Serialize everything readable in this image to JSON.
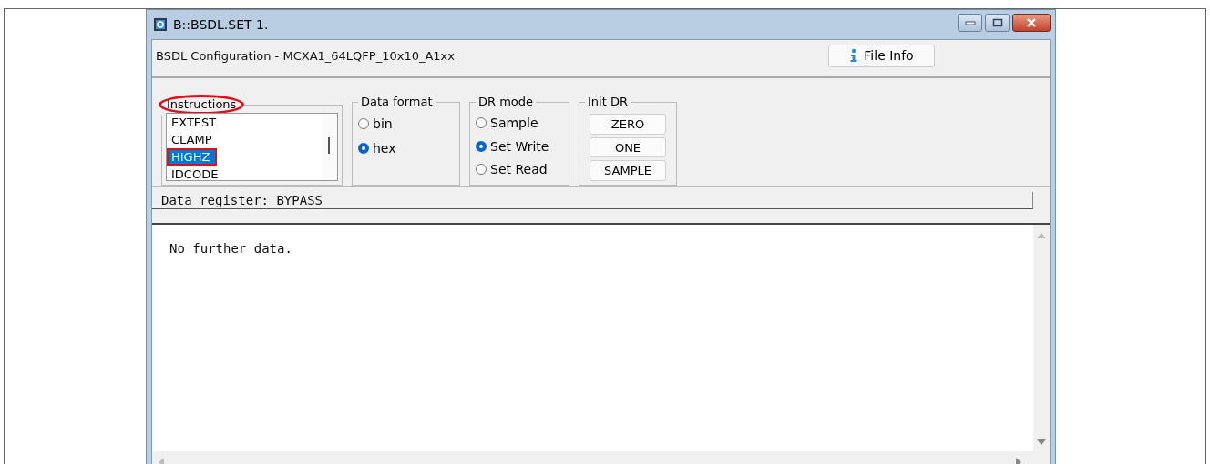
{
  "window": {
    "title": "B::BSDL.SET 1."
  },
  "header": {
    "label": "BSDL Configuration -  MCXA1_64LQFP_10x10_A1xx",
    "button": "File Info"
  },
  "instructions": {
    "title": "Instructions",
    "circled": true,
    "items": [
      {
        "label": "EXTEST",
        "selected": false,
        "boxed": false
      },
      {
        "label": "CLAMP",
        "selected": false,
        "boxed": false
      },
      {
        "label": "HIGHZ",
        "selected": true,
        "boxed": true
      },
      {
        "label": "IDCODE",
        "selected": false,
        "boxed": false
      }
    ]
  },
  "data_format": {
    "title": "Data format",
    "options": [
      {
        "label": "bin",
        "selected": false
      },
      {
        "label": "hex",
        "selected": true
      }
    ]
  },
  "dr_mode": {
    "title": "DR mode",
    "options": [
      {
        "label": "Sample",
        "selected": false
      },
      {
        "label": "Set Write",
        "selected": true
      },
      {
        "label": "Set Read",
        "selected": false
      }
    ]
  },
  "init_dr": {
    "title": "Init DR",
    "buttons": [
      "ZERO",
      "ONE",
      "SAMPLE"
    ]
  },
  "data_register": "Data register: BYPASS",
  "content": "No further data."
}
